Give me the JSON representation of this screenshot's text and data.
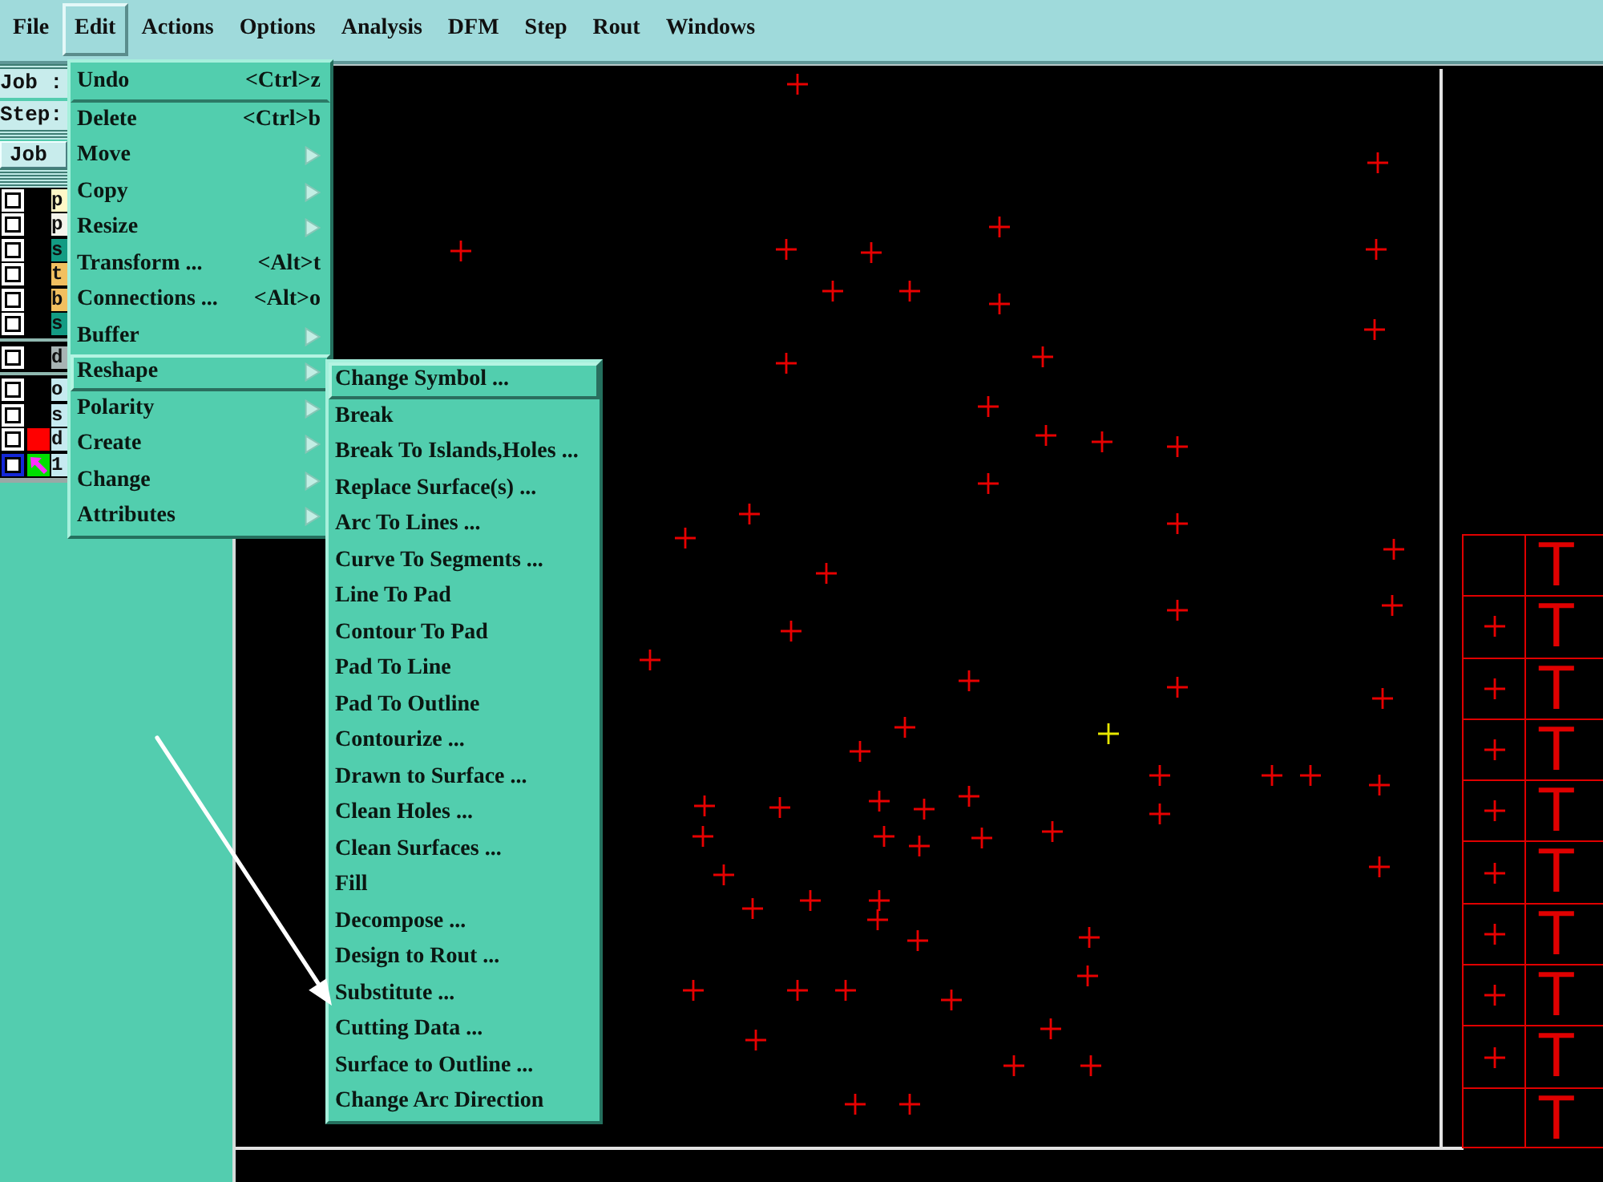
{
  "menubar": [
    {
      "label": "File",
      "selected": false
    },
    {
      "label": "Edit",
      "selected": true
    },
    {
      "label": "Actions",
      "selected": false
    },
    {
      "label": "Options",
      "selected": false
    },
    {
      "label": "Analysis",
      "selected": false
    },
    {
      "label": "DFM",
      "selected": false
    },
    {
      "label": "Step",
      "selected": false
    },
    {
      "label": "Rout",
      "selected": false
    },
    {
      "label": "Windows",
      "selected": false
    }
  ],
  "job_panel": {
    "job_label": "Job :",
    "step_label": "Step:",
    "job_button": "Job"
  },
  "layer_groups": [
    {
      "layers": [
        {
          "label": "p",
          "color": "#fff8c8",
          "checked": false,
          "work_layer": false
        },
        {
          "label": "p",
          "color": "#f4f4ec",
          "checked": false,
          "work_layer": false
        },
        {
          "label": "s",
          "color": "#139c84",
          "checked": false,
          "work_layer": false
        },
        {
          "label": "t",
          "color": "#f2c060",
          "checked": false,
          "work_layer": false
        },
        {
          "label": "b",
          "color": "#f2c060",
          "checked": false,
          "work_layer": false
        },
        {
          "label": "s",
          "color": "#139c84",
          "checked": false,
          "work_layer": false
        }
      ]
    },
    {
      "layers": [
        {
          "label": "d",
          "color": "#a8b4b4",
          "checked": false,
          "work_layer": false
        }
      ]
    },
    {
      "layers": [
        {
          "label": "o",
          "color": "#c6eaf0",
          "checked": false,
          "work_layer": false
        },
        {
          "label": "s",
          "color": "#c6eaf0",
          "checked": false,
          "work_layer": false
        },
        {
          "label": "d",
          "color": "#c6eaf0",
          "swatch": {
            "color": "#ff0000"
          },
          "checked": false,
          "work_layer": false
        },
        {
          "label": "1",
          "color": "#c6eaf0",
          "swatch": {
            "color": "#00e000"
          },
          "checked": false,
          "work_layer": true
        }
      ]
    }
  ],
  "edit_menu": {
    "items": [
      {
        "label": "Undo",
        "shortcut": "<Ctrl>z",
        "submenu": false,
        "selected": false,
        "separator_after": true
      },
      {
        "label": "Delete",
        "shortcut": "<Ctrl>b",
        "submenu": false,
        "selected": false,
        "separator_after": false
      },
      {
        "label": "Move",
        "submenu": true,
        "selected": false,
        "separator_after": false
      },
      {
        "label": "Copy",
        "submenu": true,
        "selected": false,
        "separator_after": false
      },
      {
        "label": "Resize",
        "submenu": true,
        "selected": false,
        "separator_after": false
      },
      {
        "label": "Transform ...",
        "shortcut": "<Alt>t",
        "submenu": false,
        "selected": false,
        "separator_after": false
      },
      {
        "label": "Connections ...",
        "shortcut": "<Alt>o",
        "submenu": false,
        "selected": false,
        "separator_after": false
      },
      {
        "label": "Buffer",
        "submenu": true,
        "selected": false,
        "separator_after": false
      },
      {
        "label": "Reshape",
        "submenu": true,
        "selected": true,
        "separator_after": false
      },
      {
        "label": "Polarity",
        "submenu": true,
        "selected": false,
        "separator_after": false
      },
      {
        "label": "Create",
        "submenu": true,
        "selected": false,
        "separator_after": false
      },
      {
        "label": "Change",
        "submenu": true,
        "selected": false,
        "separator_after": false
      },
      {
        "label": "Attributes",
        "submenu": true,
        "selected": false,
        "separator_after": false
      }
    ]
  },
  "reshape_menu": {
    "items": [
      {
        "label": "Change Symbol ...",
        "selected": true
      },
      {
        "label": "Break",
        "selected": false
      },
      {
        "label": "Break To Islands,Holes ...",
        "selected": false
      },
      {
        "label": "Replace Surface(s) ...",
        "selected": false
      },
      {
        "label": "Arc To Lines ...",
        "selected": false
      },
      {
        "label": "Curve To Segments ...",
        "selected": false
      },
      {
        "label": "Line To Pad",
        "selected": false
      },
      {
        "label": "Contour To Pad",
        "selected": false
      },
      {
        "label": "Pad To Line",
        "selected": false
      },
      {
        "label": "Pad To Outline",
        "selected": false
      },
      {
        "label": "Contourize ...",
        "selected": false
      },
      {
        "label": "Drawn to Surface ...",
        "selected": false
      },
      {
        "label": "Clean Holes ...",
        "selected": false
      },
      {
        "label": "Clean Surfaces ...",
        "selected": false
      },
      {
        "label": "Fill",
        "selected": false
      },
      {
        "label": "Decompose ...",
        "selected": false
      },
      {
        "label": "Design to Rout ...",
        "selected": false
      },
      {
        "label": "Substitute ...",
        "selected": false
      },
      {
        "label": "Cutting Data ...",
        "selected": false
      },
      {
        "label": "Surface to Outline ...",
        "selected": false
      },
      {
        "label": "Change Arc Direction",
        "selected": false
      }
    ]
  },
  "drill_table": {
    "rows": [
      {
        "text": "T",
        "symbol": false
      },
      {
        "text": "T",
        "symbol": true
      },
      {
        "text": "T",
        "symbol": true
      },
      {
        "text": "T",
        "symbol": true
      },
      {
        "text": "T",
        "symbol": true
      },
      {
        "text": "T",
        "symbol": true
      },
      {
        "text": "T",
        "symbol": true
      },
      {
        "text": "T",
        "symbol": true
      },
      {
        "text": "T",
        "symbol": true
      },
      {
        "text": "T",
        "symbol": false
      }
    ]
  }
}
